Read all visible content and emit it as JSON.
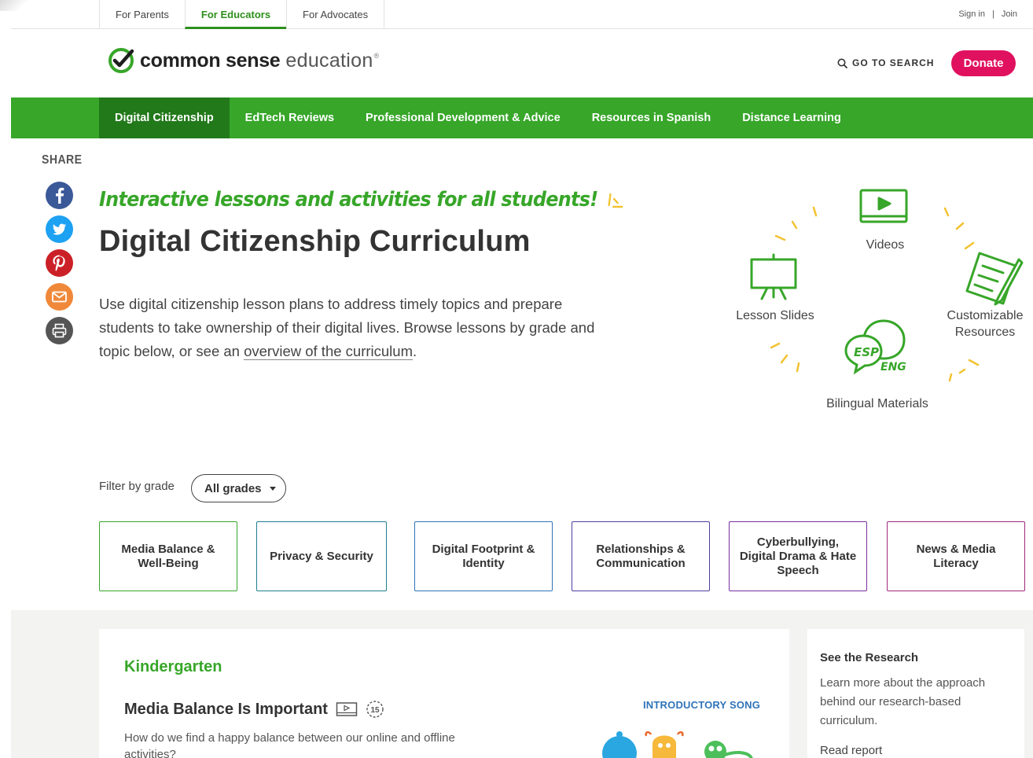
{
  "utility": {
    "tabs": [
      {
        "label": "For Parents"
      },
      {
        "label": "For Educators"
      },
      {
        "label": "For Advocates"
      }
    ],
    "sign_in": "Sign in",
    "separator": "|",
    "join": "Join"
  },
  "header": {
    "logo_word1": "common sense",
    "logo_word2": "education",
    "logo_mark": "®",
    "search": "GO TO SEARCH",
    "donate": "Donate"
  },
  "nav": {
    "items": [
      {
        "label": "Digital Citizenship"
      },
      {
        "label": "EdTech Reviews"
      },
      {
        "label": "Professional Development & Advice"
      },
      {
        "label": "Resources in Spanish"
      },
      {
        "label": "Distance Learning"
      }
    ]
  },
  "share": {
    "label": "SHARE",
    "icons": [
      "facebook-icon",
      "twitter-icon",
      "pinterest-icon",
      "email-icon",
      "print-icon"
    ]
  },
  "hero": {
    "tagline": "Interactive lessons and activities for all students!",
    "title": "Digital Citizenship Curriculum",
    "intro": "Use digital citizenship lesson plans to address timely topics and prepare students to take ownership of their digital lives. Browse lessons by grade and topic below, or see an",
    "link": "overview of the curriculum",
    "period": ".",
    "features": {
      "videos": "Videos",
      "slides": "Lesson Slides",
      "custom_1": "Customizable",
      "custom_2": "Resources",
      "bilingual": "Bilingual Materials",
      "esp": "ESP",
      "eng": "ENG"
    }
  },
  "filter": {
    "label": "Filter by grade",
    "selected": "All grades"
  },
  "topics": [
    {
      "label": "Media Balance & Well-Being",
      "color": "#37a629"
    },
    {
      "label": "Privacy & Security",
      "color": "#1f7f8f"
    },
    {
      "label": "Digital Footprint & Identity",
      "color": "#2f74b8"
    },
    {
      "label": "Relationships & Communication",
      "color": "#4b3fa0"
    },
    {
      "label": "Cyberbullying, Digital Drama & Hate Speech",
      "color": "#7a2fa0"
    },
    {
      "label": "News & Media Literacy",
      "color": "#a0277a"
    }
  ],
  "lesson": {
    "grade": "Kindergarten",
    "title": "Media Balance Is Important",
    "duration": "15",
    "description": "How do we find a happy balance between our online and offline activities?",
    "tag": "INTRODUCTORY SONG"
  },
  "research": {
    "title": "See the Research",
    "text": "Learn more about the approach behind our research-based curriculum.",
    "link": "Read report"
  }
}
